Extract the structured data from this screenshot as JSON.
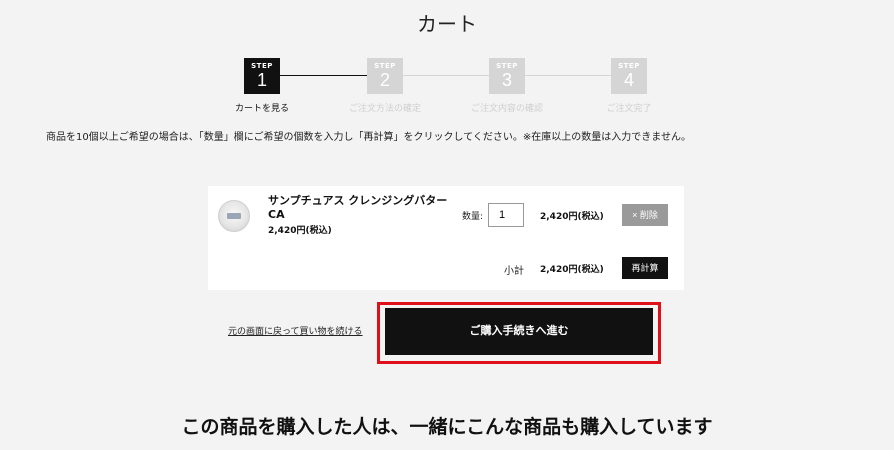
{
  "page": {
    "title": "カート"
  },
  "steps": [
    {
      "word": "STEP",
      "num": "1",
      "label": "カートを見る",
      "state": "active"
    },
    {
      "word": "STEP",
      "num": "2",
      "label": "ご注文方法の確定",
      "state": "inactive"
    },
    {
      "word": "STEP",
      "num": "3",
      "label": "ご注文内容の確認",
      "state": "inactive"
    },
    {
      "word": "STEP",
      "num": "4",
      "label": "ご注文完了",
      "state": "inactive"
    }
  ],
  "notice": "商品を10個以上ご希望の場合は、「数量」欄にご希望の個数を入力し「再計算」をクリックしてください。※在庫以上の数量は入力できません。",
  "cart": {
    "item": {
      "name": "サンプチュアス クレンジングバター CA",
      "price": "2,420円(税込)",
      "qty_label": "数量:",
      "qty_value": "1",
      "line_price": "2,420円(税込)",
      "delete_label": "× 削除"
    },
    "subtotal_label": "小計",
    "subtotal_value": "2,420円(税込)",
    "recalc_label": "再計算"
  },
  "actions": {
    "continue_link": "元の画面に戻って買い物を続ける",
    "checkout_label": "ご購入手続きへ進む"
  },
  "recommend": {
    "title": "この商品を購入した人は、一緒にこんな商品も購入しています"
  },
  "colors": {
    "highlight": "#e0101a",
    "active_step": "#111111",
    "inactive_step": "#d5d5d5"
  }
}
